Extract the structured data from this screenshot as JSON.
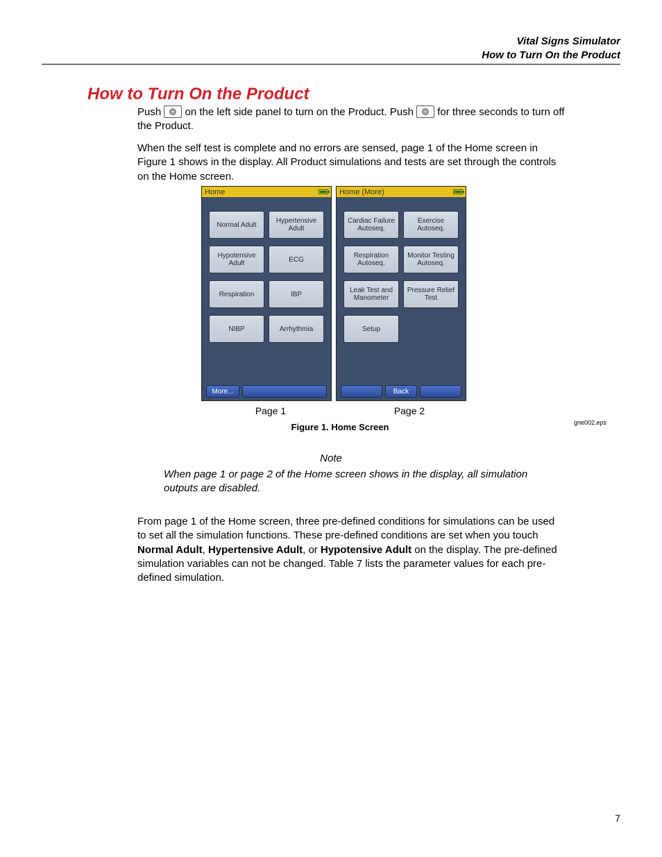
{
  "header": {
    "line1": "Vital Signs Simulator",
    "line2": "How to Turn On the Product"
  },
  "section_title": "How to Turn On the Product",
  "para1_a": "Push ",
  "para1_b": " on the left side panel to turn on the Product. Push ",
  "para1_c": " for three seconds to turn off the Product.",
  "para2": "When the self test is complete and no errors are sensed, page 1 of the Home screen in Figure 1 shows in the display. All Product simulations and tests are set through the controls on the Home screen.",
  "screen1": {
    "title": "Home",
    "buttons": [
      "Normal Adult",
      "Hypertensive Adult",
      "Hypotensive Adult",
      "ECG",
      "Respiration",
      "IBP",
      "NIBP",
      "Arrhythmia"
    ],
    "footer_left": "More..."
  },
  "screen2": {
    "title": "Home (More)",
    "buttons": [
      "Cardiac Failure Autoseq.",
      "Exercise Autoseq.",
      "Respiration Autoseq.",
      "Monitor Testing Autoseq.",
      "Leak Test and Manometer",
      "Pressure Relief Test",
      "Setup"
    ],
    "footer_back": "Back"
  },
  "page_label1": "Page 1",
  "page_label2": "Page 2",
  "figure_caption": "Figure 1. Home Screen",
  "eps_label": "gne002.eps",
  "note_label": "Note",
  "note_text": "When page 1 or page 2 of the Home screen shows in the display, all simulation outputs are disabled.",
  "para3_a": "From page 1 of the Home screen, three pre-defined conditions for simulations can be used to set all the simulation functions. These pre-defined conditions are set when you touch ",
  "para3_b1": "Normal Adult",
  "para3_c1": ", ",
  "para3_b2": "Hypertensive Adult",
  "para3_c2": ", or ",
  "para3_b3": "Hypotensive Adult",
  "para3_d": " on the display. The pre-defined simulation variables can not be changed. Table 7 lists the parameter values for each pre-defined simulation.",
  "page_number": "7"
}
